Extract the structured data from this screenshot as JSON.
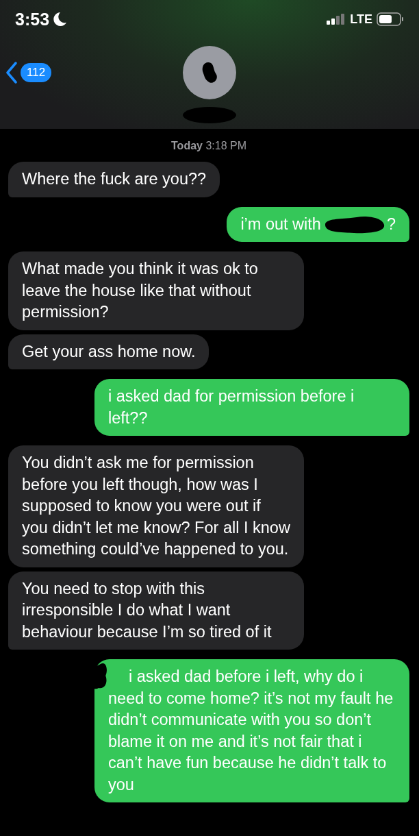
{
  "status_bar": {
    "time": "3:53",
    "network": "LTE"
  },
  "header": {
    "back_count": "112"
  },
  "timestamp": "**Today** 3:18 PM",
  "messages": [
    {
      "kind": "received",
      "text": "Where the fuck are you??",
      "tail": true
    },
    {
      "kind": "sent",
      "text": "i’m out with",
      "text_after": "?",
      "redacted": true,
      "tail": true
    },
    {
      "kind": "received",
      "text": "What made you think it was ok to leave the house like that without permission?",
      "tail": false
    },
    {
      "kind": "received",
      "text": "Get your ass home now.",
      "tail": true
    },
    {
      "kind": "sent",
      "text": "i asked dad for permission before i left??",
      "tail": true
    },
    {
      "kind": "received",
      "text": "You didn’t ask me for permission before you left though, how was I supposed to know you were out if you didn’t let me know? For all I know something could’ve happened to you.",
      "tail": false
    },
    {
      "kind": "received",
      "text": "You need to stop with this irresponsible I do what I want behaviour because I’m so tired of it",
      "tail": true
    },
    {
      "kind": "sent",
      "text": "i asked dad before i left, why do i need to come home? it’s not my fault he didn’t communicate with you so don’t blame it on me and it’s not fair that i can’t have fun because he didn’t talk to you",
      "redacted": true,
      "tail": true
    }
  ]
}
